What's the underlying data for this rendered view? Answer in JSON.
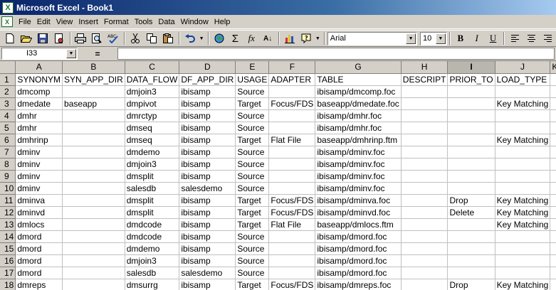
{
  "window": {
    "title": "Microsoft Excel - Book1",
    "app_icon_glyph": "X"
  },
  "menu": [
    "File",
    "Edit",
    "View",
    "Insert",
    "Format",
    "Tools",
    "Data",
    "Window",
    "Help"
  ],
  "toolbar": {
    "font_name": "Arial",
    "font_size": "10",
    "bold_label": "B",
    "italic_label": "I",
    "underline_label": "U",
    "sum_label": "Σ",
    "fx_label": "fx",
    "sort_label": "A↓"
  },
  "formula": {
    "name_box": "I33",
    "equals": "="
  },
  "grid": {
    "columns": [
      "A",
      "B",
      "C",
      "D",
      "E",
      "F",
      "G",
      "H",
      "I",
      "J",
      "K"
    ],
    "active_column": "I",
    "rows": [
      {
        "num": "1",
        "cells": [
          "SYNONYM",
          "SYN_APP_DIR",
          "DATA_FLOW",
          "DF_APP_DIR",
          "USAGE",
          "ADAPTER",
          "TABLE",
          "DESCRIPT",
          "PRIOR_TO",
          "LOAD_TYPE",
          ""
        ]
      },
      {
        "num": "2",
        "cells": [
          "dmcomp",
          "",
          "dmjoin3",
          "ibisamp",
          "Source",
          "",
          "ibisamp/dmcomp.foc",
          "",
          "",
          "",
          ""
        ]
      },
      {
        "num": "3",
        "cells": [
          "dmedate",
          "baseapp",
          "dmpivot",
          "ibisamp",
          "Target",
          "Focus/FDS",
          "baseapp/dmedate.foc",
          "",
          "",
          "Key Matching",
          ""
        ]
      },
      {
        "num": "4",
        "cells": [
          "dmhr",
          "",
          "dmrctyp",
          "ibisamp",
          "Source",
          "",
          "ibisamp/dmhr.foc",
          "",
          "",
          "",
          ""
        ]
      },
      {
        "num": "5",
        "cells": [
          "dmhr",
          "",
          "dmseq",
          "ibisamp",
          "Source",
          "",
          "ibisamp/dmhr.foc",
          "",
          "",
          "",
          ""
        ]
      },
      {
        "num": "6",
        "cells": [
          "dmhrinp",
          "",
          "dmseq",
          "ibisamp",
          "Target",
          "Flat File",
          "baseapp/dmhrinp.ftm",
          "",
          "",
          "Key Matching",
          ""
        ]
      },
      {
        "num": "7",
        "cells": [
          "dminv",
          "",
          "dmdemo",
          "ibisamp",
          "Source",
          "",
          "ibisamp/dminv.foc",
          "",
          "",
          "",
          ""
        ]
      },
      {
        "num": "8",
        "cells": [
          "dminv",
          "",
          "dmjoin3",
          "ibisamp",
          "Source",
          "",
          "ibisamp/dminv.foc",
          "",
          "",
          "",
          ""
        ]
      },
      {
        "num": "9",
        "cells": [
          "dminv",
          "",
          "dmsplit",
          "ibisamp",
          "Source",
          "",
          "ibisamp/dminv.foc",
          "",
          "",
          "",
          ""
        ]
      },
      {
        "num": "10",
        "cells": [
          "dminv",
          "",
          "salesdb",
          "salesdemo",
          "Source",
          "",
          "ibisamp/dminv.foc",
          "",
          "",
          "",
          ""
        ]
      },
      {
        "num": "11",
        "cells": [
          "dminva",
          "",
          "dmsplit",
          "ibisamp",
          "Target",
          "Focus/FDS",
          "ibisamp/dminva.foc",
          "",
          "Drop",
          "Key Matching",
          ""
        ]
      },
      {
        "num": "12",
        "cells": [
          "dminvd",
          "",
          "dmsplit",
          "ibisamp",
          "Target",
          "Focus/FDS",
          "ibisamp/dminvd.foc",
          "",
          "Delete",
          "Key Matching",
          ""
        ]
      },
      {
        "num": "13",
        "cells": [
          "dmlocs",
          "",
          "dmdcode",
          "ibisamp",
          "Target",
          "Flat File",
          "baseapp/dmlocs.ftm",
          "",
          "",
          "Key Matching",
          ""
        ]
      },
      {
        "num": "14",
        "cells": [
          "dmord",
          "",
          "dmdcode",
          "ibisamp",
          "Source",
          "",
          "ibisamp/dmord.foc",
          "",
          "",
          "",
          ""
        ]
      },
      {
        "num": "15",
        "cells": [
          "dmord",
          "",
          "dmdemo",
          "ibisamp",
          "Source",
          "",
          "ibisamp/dmord.foc",
          "",
          "",
          "",
          ""
        ]
      },
      {
        "num": "16",
        "cells": [
          "dmord",
          "",
          "dmjoin3",
          "ibisamp",
          "Source",
          "",
          "ibisamp/dmord.foc",
          "",
          "",
          "",
          ""
        ]
      },
      {
        "num": "17",
        "cells": [
          "dmord",
          "",
          "salesdb",
          "salesdemo",
          "Source",
          "",
          "ibisamp/dmord.foc",
          "",
          "",
          "",
          ""
        ]
      },
      {
        "num": "18",
        "cells": [
          "dmreps",
          "",
          "dmsurrg",
          "ibisamp",
          "Target",
          "Focus/FDS",
          "ibisamp/dmreps.foc",
          "",
          "Drop",
          "Key Matching",
          ""
        ]
      }
    ]
  }
}
